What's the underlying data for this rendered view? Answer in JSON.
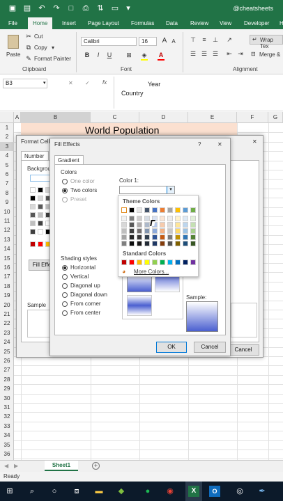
{
  "titlebar": {
    "watermark": "@cheatsheets"
  },
  "tabs": [
    "File",
    "Home",
    "Insert",
    "Page Layout",
    "Formulas",
    "Data",
    "Review",
    "View",
    "Developer",
    "H"
  ],
  "ribbon": {
    "cut": "Cut",
    "copy": "Copy",
    "copy_arrow": "▾",
    "format_painter": "Format Painter",
    "paste": "Paste",
    "font_name": "Calibri",
    "font_size": "16",
    "wrap_text": "Wrap Tex",
    "merge": "Merge &",
    "groups": {
      "clipboard": "Clipboard",
      "font": "Font",
      "alignment": "Alignment"
    },
    "bold": "B",
    "italic": "I",
    "underline": "U"
  },
  "formula_bar": {
    "name_box": "B3",
    "line1": "Year",
    "line2": "Country",
    "cancel": "✕",
    "enter": "✓",
    "fx": "fx"
  },
  "grid": {
    "columns": [
      "A",
      "B",
      "C",
      "D",
      "E",
      "F",
      "G"
    ],
    "rows": [
      "1",
      "2",
      "3",
      "4",
      "5",
      "6",
      "7",
      "8",
      "9",
      "10",
      "11",
      "12",
      "13",
      "14",
      "15",
      "16",
      "17",
      "18",
      "19",
      "20",
      "21",
      "22",
      "23",
      "24",
      "25",
      "26",
      "27",
      "28",
      "29",
      "30",
      "31",
      "32",
      "33",
      "34",
      "35",
      "36"
    ],
    "title_cell": "World Population"
  },
  "sheet_tabs": {
    "sheet1": "Sheet1",
    "add": "+"
  },
  "status": {
    "ready": "Ready"
  },
  "format_cells": {
    "title": "Format Cell",
    "tab_number": "Number",
    "background": "Backgrou",
    "fill_effects_btn": "Fill Effe",
    "sample": "Sample",
    "cancel": "Cancel",
    "close": "✕"
  },
  "fill_effects": {
    "title": "Fill Effects",
    "help": "?",
    "close": "✕",
    "tab": "Gradient",
    "colors_label": "Colors",
    "one_color": "One color",
    "two_colors": "Two colors",
    "preset": "Preset",
    "color1_label": "Color 1:",
    "shading_label": "Shading styles",
    "shading": [
      "Horizontal",
      "Vertical",
      "Diagonal up",
      "Diagonal down",
      "From corner",
      "From center"
    ],
    "sample": "Sample:",
    "ok": "OK",
    "cancel": "Cancel"
  },
  "palette": {
    "theme_header": "Theme Colors",
    "standard_header": "Standard Colors",
    "more_colors": "More Colors...",
    "theme_top": [
      "#ffffff",
      "#000000",
      "#e7e6e6",
      "#44546a",
      "#4472c4",
      "#ed7d31",
      "#a5a5a5",
      "#ffc000",
      "#5b9bd5",
      "#70ad47"
    ],
    "theme_shades": [
      [
        "#f2f2f2",
        "#7f7f7f",
        "#d0cece",
        "#d6dce4",
        "#d9e2f3",
        "#fbe5d5",
        "#ededed",
        "#fff2cc",
        "#deeaf6",
        "#e2efd9"
      ],
      [
        "#d8d8d8",
        "#595959",
        "#aeabab",
        "#adb9ca",
        "#b4c6e7",
        "#f7cbac",
        "#dbdbdb",
        "#fee599",
        "#bdd6ee",
        "#c5e0b3"
      ],
      [
        "#bfbfbf",
        "#3f3f3f",
        "#757070",
        "#8496b0",
        "#8eaadb",
        "#f4b183",
        "#c9c9c9",
        "#ffd965",
        "#9cc3e5",
        "#a8d08d"
      ],
      [
        "#a5a5a5",
        "#262626",
        "#3a3838",
        "#323f4f",
        "#2f5496",
        "#c55a11",
        "#7b7b7b",
        "#bf9000",
        "#2e75b5",
        "#538135"
      ],
      [
        "#7f7f7f",
        "#0c0c0c",
        "#171616",
        "#222a35",
        "#1f3864",
        "#833c0b",
        "#525252",
        "#7f6000",
        "#1e4e79",
        "#375623"
      ]
    ],
    "standard": [
      "#c00000",
      "#ff0000",
      "#ffc000",
      "#ffff00",
      "#92d050",
      "#00b050",
      "#00b0f0",
      "#0070c0",
      "#002060",
      "#7030a0"
    ]
  }
}
